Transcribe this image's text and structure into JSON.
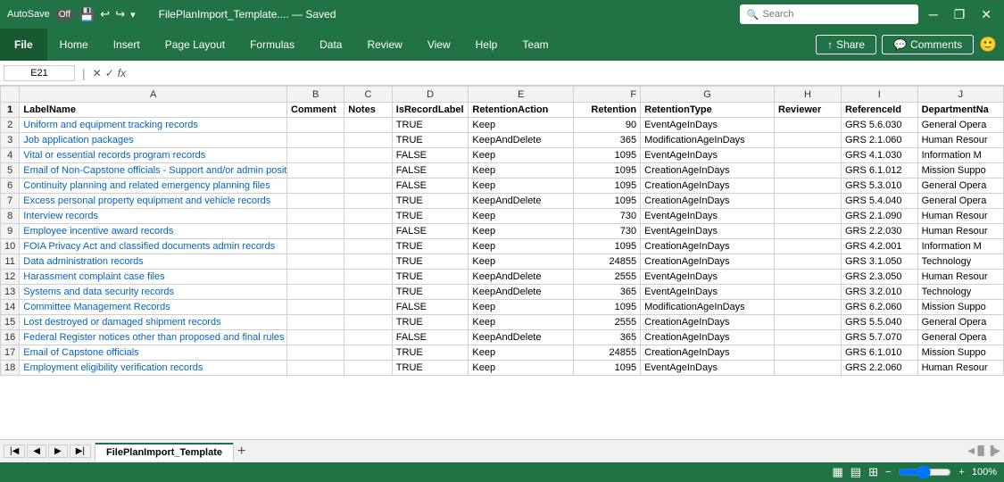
{
  "titleBar": {
    "autosave": "AutoSave",
    "autosave_state": "Off",
    "filename": "FilePlanImport_Template....  — Saved",
    "search_placeholder": "Search"
  },
  "ribbonTabs": [
    "File",
    "Home",
    "Insert",
    "Page Layout",
    "Formulas",
    "Data",
    "Review",
    "View",
    "Help",
    "Team"
  ],
  "ribbon": {
    "share_label": "Share",
    "comments_label": "Comments"
  },
  "formulaBar": {
    "cell_ref": "E21",
    "formula": ""
  },
  "spreadsheet": {
    "col_headers": [
      "",
      "A",
      "B",
      "C",
      "D",
      "E",
      "F",
      "G",
      "H",
      "I",
      "J"
    ],
    "header_row": [
      "LabelName",
      "Comment",
      "Notes",
      "IsRecordLabel",
      "RetentionAction",
      "Retention",
      "RetentionType",
      "Reviewer",
      "ReferenceId",
      "DepartmentNa"
    ],
    "rows": [
      {
        "num": 2,
        "A": "Uniform and equipment tracking records",
        "B": "",
        "C": "",
        "D": "TRUE",
        "E": "Keep",
        "F": "90",
        "G": "EventAgeInDays",
        "H": "",
        "I": "GRS 5.6.030",
        "J": "General Opera"
      },
      {
        "num": 3,
        "A": "Job application packages",
        "B": "",
        "C": "",
        "D": "TRUE",
        "E": "KeepAndDelete",
        "F": "365",
        "G": "ModificationAgeInDays",
        "H": "",
        "I": "GRS 2.1.060",
        "J": "Human Resour"
      },
      {
        "num": 4,
        "A": "Vital or essential records program records",
        "B": "",
        "C": "",
        "D": "FALSE",
        "E": "Keep",
        "F": "1095",
        "G": "EventAgeInDays",
        "H": "",
        "I": "GRS 4.1.030",
        "J": "Information M"
      },
      {
        "num": 5,
        "A": "Email of Non-Capstone officials - Support and/or admin positions",
        "B": "",
        "C": "",
        "D": "FALSE",
        "E": "Keep",
        "F": "1095",
        "G": "CreationAgeInDays",
        "H": "",
        "I": "GRS 6.1.012",
        "J": "Mission Suppo"
      },
      {
        "num": 6,
        "A": "Continuity planning and related emergency planning files",
        "B": "",
        "C": "",
        "D": "FALSE",
        "E": "Keep",
        "F": "1095",
        "G": "CreationAgeInDays",
        "H": "",
        "I": "GRS 5.3.010",
        "J": "General Opera"
      },
      {
        "num": 7,
        "A": "Excess personal property equipment and vehicle records",
        "B": "",
        "C": "",
        "D": "TRUE",
        "E": "KeepAndDelete",
        "F": "1095",
        "G": "CreationAgeInDays",
        "H": "",
        "I": "GRS 5.4.040",
        "J": "General Opera"
      },
      {
        "num": 8,
        "A": "Interview records",
        "B": "",
        "C": "",
        "D": "TRUE",
        "E": "Keep",
        "F": "730",
        "G": "EventAgeInDays",
        "H": "",
        "I": "GRS 2.1.090",
        "J": "Human Resour"
      },
      {
        "num": 9,
        "A": "Employee incentive award records",
        "B": "",
        "C": "",
        "D": "FALSE",
        "E": "Keep",
        "F": "730",
        "G": "EventAgeInDays",
        "H": "",
        "I": "GRS 2.2.030",
        "J": "Human Resour"
      },
      {
        "num": 10,
        "A": "FOIA Privacy Act and classified documents admin records",
        "B": "",
        "C": "",
        "D": "TRUE",
        "E": "Keep",
        "F": "1095",
        "G": "CreationAgeInDays",
        "H": "",
        "I": "GRS 4.2.001",
        "J": "Information M"
      },
      {
        "num": 11,
        "A": "Data administration records",
        "B": "",
        "C": "",
        "D": "TRUE",
        "E": "Keep",
        "F": "24855",
        "G": "CreationAgeInDays",
        "H": "",
        "I": "GRS 3.1.050",
        "J": "Technology"
      },
      {
        "num": 12,
        "A": "Harassment complaint case files",
        "B": "",
        "C": "",
        "D": "TRUE",
        "E": "KeepAndDelete",
        "F": "2555",
        "G": "EventAgeInDays",
        "H": "",
        "I": "GRS 2.3.050",
        "J": "Human Resour"
      },
      {
        "num": 13,
        "A": "Systems and data security records",
        "B": "",
        "C": "",
        "D": "TRUE",
        "E": "KeepAndDelete",
        "F": "365",
        "G": "EventAgeInDays",
        "H": "",
        "I": "GRS 3.2.010",
        "J": "Technology"
      },
      {
        "num": 14,
        "A": "Committee Management Records",
        "B": "",
        "C": "",
        "D": "FALSE",
        "E": "Keep",
        "F": "1095",
        "G": "ModificationAgeInDays",
        "H": "",
        "I": "GRS 6.2.060",
        "J": "Mission Suppo"
      },
      {
        "num": 15,
        "A": "Lost destroyed or damaged shipment records",
        "B": "",
        "C": "",
        "D": "TRUE",
        "E": "Keep",
        "F": "2555",
        "G": "CreationAgeInDays",
        "H": "",
        "I": "GRS 5.5.040",
        "J": "General Opera"
      },
      {
        "num": 16,
        "A": "Federal Register notices other than proposed and final rules",
        "B": "",
        "C": "",
        "D": "FALSE",
        "E": "KeepAndDelete",
        "F": "365",
        "G": "CreationAgeInDays",
        "H": "",
        "I": "GRS 5.7.070",
        "J": "General Opera"
      },
      {
        "num": 17,
        "A": "Email of Capstone officials",
        "B": "",
        "C": "",
        "D": "TRUE",
        "E": "Keep",
        "F": "24855",
        "G": "CreationAgeInDays",
        "H": "",
        "I": "GRS 6.1.010",
        "J": "Mission Suppo"
      },
      {
        "num": 18,
        "A": "Employment eligibility verification records",
        "B": "",
        "C": "",
        "D": "TRUE",
        "E": "Keep",
        "F": "1095",
        "G": "EventAgeInDays",
        "H": "",
        "I": "GRS 2.2.060",
        "J": "Human Resour"
      }
    ]
  },
  "sheetTab": {
    "name": "FilePlanImport_Template"
  },
  "statusBar": {
    "zoom": "100%",
    "view_normal": "Normal",
    "view_layout": "Page Layout",
    "view_break": "Page Break"
  }
}
